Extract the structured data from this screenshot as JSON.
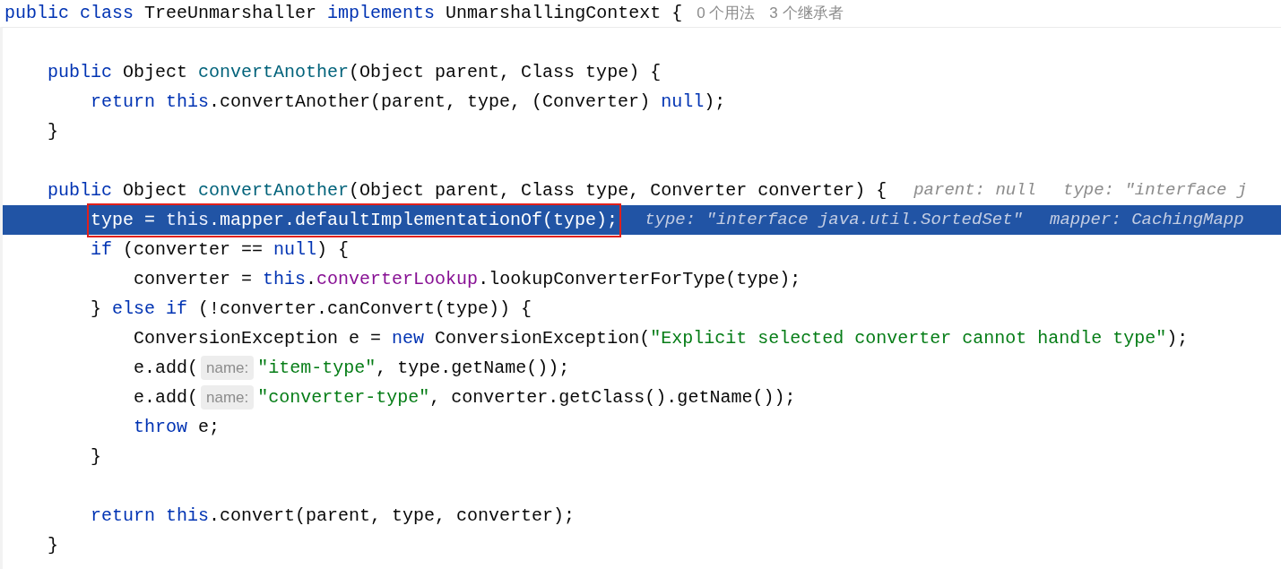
{
  "header": {
    "segments": [
      {
        "kind": "code",
        "tokens": [
          {
            "kind": "kw",
            "text": "public class "
          },
          {
            "kind": "plain",
            "text": "TreeUnmarshaller "
          },
          {
            "kind": "kw",
            "text": "implements "
          },
          {
            "kind": "plain",
            "text": "UnmarshallingContext {"
          }
        ]
      },
      {
        "kind": "usage",
        "text": "0 个用法"
      },
      {
        "kind": "usage",
        "text": "3 个继承者"
      }
    ]
  },
  "lines": [
    {
      "selected": false
    },
    {
      "selected": false,
      "segments": [
        {
          "kind": "code",
          "tokens": [
            {
              "kind": "kw",
              "text": "    public "
            },
            {
              "kind": "plain",
              "text": "Object "
            },
            {
              "kind": "decl",
              "text": "convertAnother"
            },
            {
              "kind": "plain",
              "text": "(Object parent, Class type) {"
            }
          ]
        }
      ]
    },
    {
      "selected": false,
      "segments": [
        {
          "kind": "code",
          "tokens": [
            {
              "kind": "kw",
              "text": "        return this"
            },
            {
              "kind": "plain",
              "text": ".convertAnother(parent, type, (Converter) "
            },
            {
              "kind": "kw",
              "text": "null"
            },
            {
              "kind": "plain",
              "text": ");"
            }
          ]
        }
      ]
    },
    {
      "selected": false,
      "segments": [
        {
          "kind": "code",
          "tokens": [
            {
              "kind": "plain",
              "text": "    }"
            }
          ]
        }
      ]
    },
    {
      "selected": false
    },
    {
      "selected": false,
      "segments": [
        {
          "kind": "code",
          "tokens": [
            {
              "kind": "kw",
              "text": "    public "
            },
            {
              "kind": "plain",
              "text": "Object "
            },
            {
              "kind": "decl",
              "text": "convertAnother"
            },
            {
              "kind": "plain",
              "text": "(Object parent, Class type, Converter converter) {"
            }
          ]
        },
        {
          "kind": "debug",
          "text": "parent: null"
        },
        {
          "kind": "debug",
          "text": "type: \"interface j"
        }
      ]
    },
    {
      "selected": true,
      "segments": [
        {
          "kind": "code",
          "boxed": true,
          "tokens": [
            {
              "kind": "plain",
              "text": "        type = "
            },
            {
              "kind": "kw",
              "text": "this"
            },
            {
              "kind": "plain",
              "text": ".mapper.defaultImplementationOf(type);"
            }
          ]
        },
        {
          "kind": "debug",
          "text": "type: \"interface java.util.SortedSet\""
        },
        {
          "kind": "debug",
          "text": "mapper: CachingMapp"
        }
      ]
    },
    {
      "selected": false,
      "segments": [
        {
          "kind": "code",
          "tokens": [
            {
              "kind": "kw",
              "text": "        if "
            },
            {
              "kind": "plain",
              "text": "(converter == "
            },
            {
              "kind": "kw",
              "text": "null"
            },
            {
              "kind": "plain",
              "text": ") {"
            }
          ]
        }
      ]
    },
    {
      "selected": false,
      "segments": [
        {
          "kind": "code",
          "tokens": [
            {
              "kind": "plain",
              "text": "            converter = "
            },
            {
              "kind": "kw",
              "text": "this"
            },
            {
              "kind": "plain",
              "text": "."
            },
            {
              "kind": "field",
              "text": "converterLookup"
            },
            {
              "kind": "plain",
              "text": ".lookupConverterForType(type);"
            }
          ]
        }
      ]
    },
    {
      "selected": false,
      "segments": [
        {
          "kind": "code",
          "tokens": [
            {
              "kind": "plain",
              "text": "        } "
            },
            {
              "kind": "kw",
              "text": "else if "
            },
            {
              "kind": "plain",
              "text": "(!converter.canConvert(type)) {"
            }
          ]
        }
      ]
    },
    {
      "selected": false,
      "segments": [
        {
          "kind": "code",
          "tokens": [
            {
              "kind": "plain",
              "text": "            ConversionException e = "
            },
            {
              "kind": "kw",
              "text": "new "
            },
            {
              "kind": "plain",
              "text": "ConversionException("
            },
            {
              "kind": "str",
              "text": "\"Explicit selected converter cannot handle type\""
            },
            {
              "kind": "plain",
              "text": ");"
            }
          ]
        }
      ]
    },
    {
      "selected": false,
      "segments": [
        {
          "kind": "code",
          "tokens": [
            {
              "kind": "plain",
              "text": "            e.add("
            }
          ]
        },
        {
          "kind": "hint",
          "text": "name:"
        },
        {
          "kind": "code",
          "tokens": [
            {
              "kind": "str",
              "text": "\"item-type\""
            },
            {
              "kind": "plain",
              "text": ", type.getName());"
            }
          ]
        }
      ]
    },
    {
      "selected": false,
      "segments": [
        {
          "kind": "code",
          "tokens": [
            {
              "kind": "plain",
              "text": "            e.add("
            }
          ]
        },
        {
          "kind": "hint",
          "text": "name:"
        },
        {
          "kind": "code",
          "tokens": [
            {
              "kind": "str",
              "text": "\"converter-type\""
            },
            {
              "kind": "plain",
              "text": ", converter.getClass().getName());"
            }
          ]
        }
      ]
    },
    {
      "selected": false,
      "segments": [
        {
          "kind": "code",
          "tokens": [
            {
              "kind": "kw",
              "text": "            throw "
            },
            {
              "kind": "plain",
              "text": "e;"
            }
          ]
        }
      ]
    },
    {
      "selected": false,
      "segments": [
        {
          "kind": "code",
          "tokens": [
            {
              "kind": "plain",
              "text": "        }"
            }
          ]
        }
      ]
    },
    {
      "selected": false
    },
    {
      "selected": false,
      "segments": [
        {
          "kind": "code",
          "tokens": [
            {
              "kind": "kw",
              "text": "        return this"
            },
            {
              "kind": "plain",
              "text": ".convert(parent, type, converter);"
            }
          ]
        }
      ]
    },
    {
      "selected": false,
      "segments": [
        {
          "kind": "code",
          "tokens": [
            {
              "kind": "plain",
              "text": "    }"
            }
          ]
        }
      ]
    }
  ]
}
